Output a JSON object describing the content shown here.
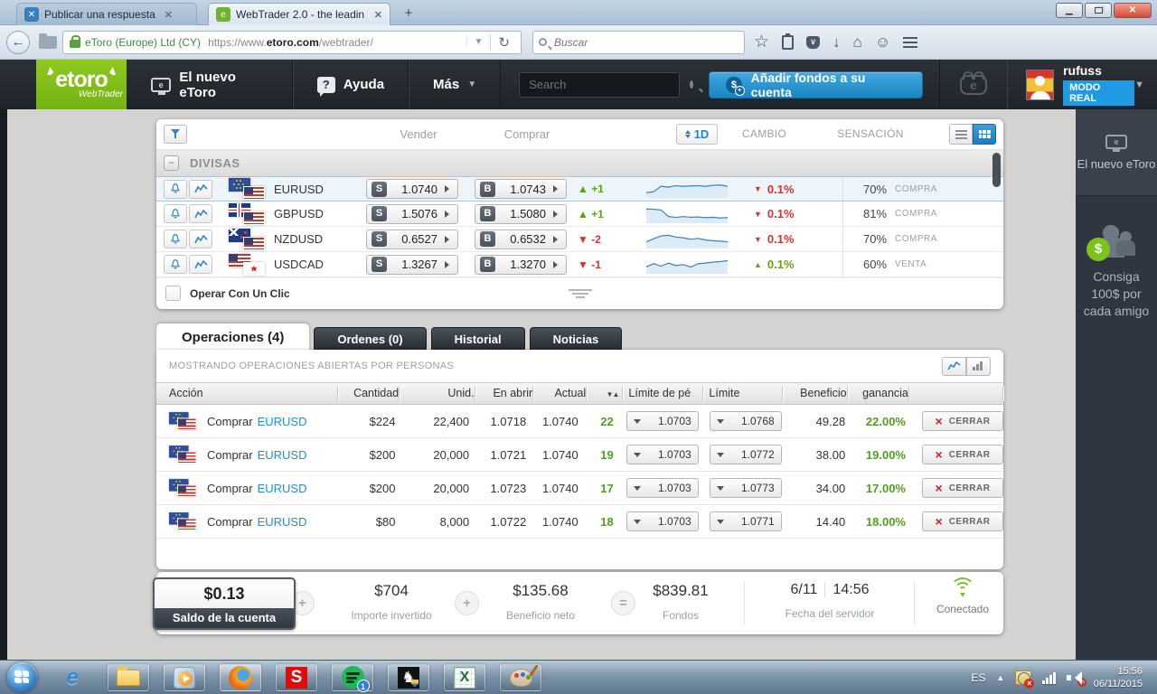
{
  "browser": {
    "tab1": "Publicar una respuesta",
    "tab2": "WebTrader 2.0 - the leadin...",
    "security": "eToro (Europe) Ltd (CY)",
    "url_prefix": "https://www.",
    "url_domain": "etoro.com",
    "url_path": "/webtrader/",
    "search_placeholder": "Buscar"
  },
  "header": {
    "logo": "etoro",
    "logo_sub": "WebTrader",
    "nav_new": "El nuevo eToro",
    "nav_help": "Ayuda",
    "nav_more": "Más",
    "search_placeholder": "Search",
    "add_funds": "Añadir fondos a su cuenta",
    "username": "rufuss",
    "mode": "MODO REAL"
  },
  "sidebar": {
    "new_etoro": "El nuevo eToro",
    "referral": "Consiga 100$ por cada amigo"
  },
  "watchlist": {
    "col_sell": "Vender",
    "col_buy": "Comprar",
    "timeframe": "1D",
    "col_change": "CAMBIO",
    "col_sentiment": "SENSACIÓN",
    "group": "DIVISAS",
    "one_click": "Operar Con Un Clic",
    "rows": [
      {
        "pair": "EURUSD",
        "flags": [
          "eu",
          "us"
        ],
        "sell": "1.0740",
        "buy": "1.0743",
        "tick": "+1",
        "tick_dir": "up",
        "change": "0.1%",
        "change_dir": "down",
        "sentiment": "70%",
        "sentiment_side": "COMPRA",
        "selected": true,
        "spark": [
          72,
          66,
          30,
          36,
          26,
          31,
          28,
          26,
          31,
          24,
          22,
          30
        ]
      },
      {
        "pair": "GBPUSD",
        "flags": [
          "gb",
          "us"
        ],
        "sell": "1.5076",
        "buy": "1.5080",
        "tick": "+1",
        "tick_dir": "up",
        "change": "0.1%",
        "change_dir": "down",
        "sentiment": "81%",
        "sentiment_side": "COMPRA",
        "selected": false,
        "spark": [
          14,
          15,
          20,
          62,
          68,
          63,
          67,
          65,
          70,
          67,
          72,
          69
        ]
      },
      {
        "pair": "NZDUSD",
        "flags": [
          "nz",
          "us"
        ],
        "sell": "0.6527",
        "buy": "0.6532",
        "tick": "-2",
        "tick_dir": "down",
        "change": "0.1%",
        "change_dir": "down",
        "sentiment": "70%",
        "sentiment_side": "COMPRA",
        "selected": false,
        "spark": [
          62,
          42,
          24,
          20,
          32,
          36,
          46,
          40,
          50,
          55,
          58,
          62
        ]
      },
      {
        "pair": "USDCAD",
        "flags": [
          "us",
          "ca"
        ],
        "sell": "1.3267",
        "buy": "1.3270",
        "tick": "-1",
        "tick_dir": "down",
        "change": "0.1%",
        "change_dir": "up",
        "sentiment": "60%",
        "sentiment_side": "VENTA",
        "selected": false,
        "spark": [
          60,
          40,
          56,
          36,
          52,
          46,
          62,
          40,
          36,
          30,
          26,
          20
        ]
      }
    ]
  },
  "tabs": [
    {
      "label": "Operaciones (4)",
      "active": true
    },
    {
      "label": "Ordenes (0)",
      "active": false
    },
    {
      "label": "Historial",
      "active": false
    },
    {
      "label": "Noticias",
      "active": false
    }
  ],
  "trades": {
    "caption": "MOSTRANDO OPERACIONES ABIERTAS POR PERSONAS",
    "headers": [
      "Acción",
      "Cantidad",
      "Unid.",
      "En abrir",
      "Actual",
      "sort",
      "Límite de pé",
      "Límite",
      "Beneficio",
      "ganancia",
      ""
    ],
    "action_label": "Comprar",
    "close_label": "CERRAR",
    "rows": [
      {
        "pair": "EURUSD",
        "flags": [
          "eu",
          "us"
        ],
        "amount": "$224",
        "units": "22,400",
        "open": "1.0718",
        "current": "1.0740",
        "pips": "22",
        "stop": "1.0703",
        "limit": "1.0768",
        "profit": "49.28",
        "gain": "22.00%"
      },
      {
        "pair": "EURUSD",
        "flags": [
          "eu",
          "us"
        ],
        "amount": "$200",
        "units": "20,000",
        "open": "1.0721",
        "current": "1.0740",
        "pips": "19",
        "stop": "1.0703",
        "limit": "1.0772",
        "profit": "38.00",
        "gain": "19.00%"
      },
      {
        "pair": "EURUSD",
        "flags": [
          "eu",
          "us"
        ],
        "amount": "$200",
        "units": "20,000",
        "open": "1.0723",
        "current": "1.0740",
        "pips": "17",
        "stop": "1.0703",
        "limit": "1.0773",
        "profit": "34.00",
        "gain": "17.00%"
      },
      {
        "pair": "EURUSD",
        "flags": [
          "eu",
          "us"
        ],
        "amount": "$80",
        "units": "8,000",
        "open": "1.0722",
        "current": "1.0740",
        "pips": "18",
        "stop": "1.0703",
        "limit": "1.0771",
        "profit": "14.40",
        "gain": "18.00%"
      }
    ]
  },
  "summary": {
    "balance": "$0.13",
    "balance_label": "Saldo de la cuenta",
    "invested": "$704",
    "invested_label": "Importe invertido",
    "net_profit": "$135.68",
    "net_profit_label": "Beneficio neto",
    "equity": "$839.81",
    "equity_label": "Fondos",
    "server_date": "6/11",
    "server_time": "14:56",
    "server_label": "Fecha del servidor",
    "connection": "Conectado"
  },
  "taskbar": {
    "lang": "ES",
    "spotify_badge": "1",
    "time": "15:56",
    "date": "06/11/2015"
  },
  "colors": {
    "accent_blue": "#1e84c8",
    "green": "#57a510",
    "red": "#d23430",
    "brand_green": "#86c11e"
  }
}
